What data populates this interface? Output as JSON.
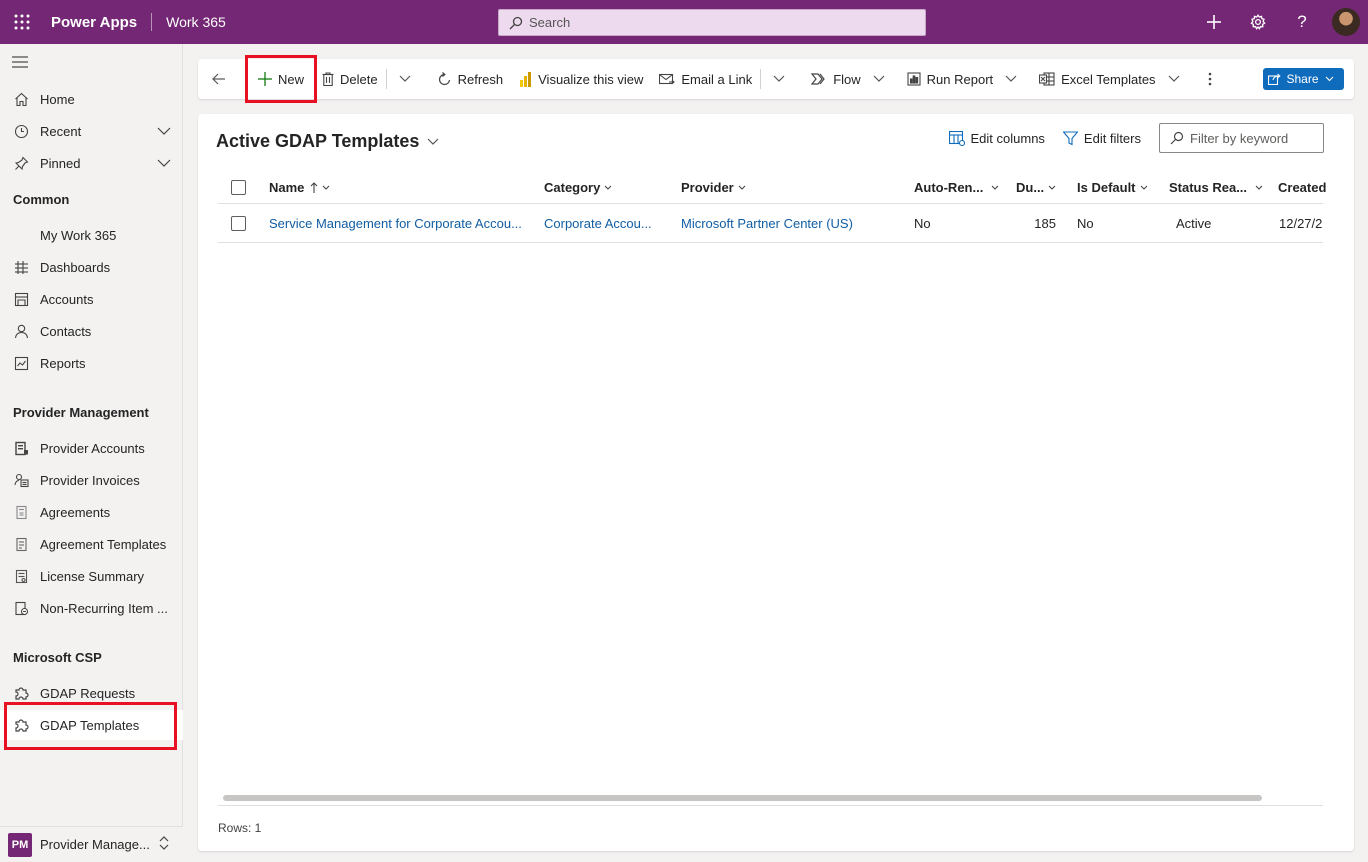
{
  "topbar": {
    "app_name": "Power Apps",
    "environment": "Work 365",
    "search_placeholder": "Search",
    "icons": [
      "waffle-icon",
      "plus-icon",
      "gear-icon",
      "help-icon",
      "avatar"
    ],
    "color": "#742774"
  },
  "sidebar": {
    "items_top": [
      {
        "label": "Home",
        "icon": "home-icon"
      },
      {
        "label": "Recent",
        "icon": "clock-icon"
      },
      {
        "label": "Pinned",
        "icon": "pin-icon"
      }
    ],
    "groups": [
      {
        "title": "Common",
        "items": [
          {
            "label": "My Work 365",
            "icon": ""
          },
          {
            "label": "Dashboards",
            "icon": "dashboard-icon"
          },
          {
            "label": "Accounts",
            "icon": "accounts-icon"
          },
          {
            "label": "Contacts",
            "icon": "contact-icon"
          },
          {
            "label": "Reports",
            "icon": "report-icon"
          }
        ]
      },
      {
        "title": "Provider Management",
        "items": [
          {
            "label": "Provider Accounts",
            "icon": "provider-accounts-icon"
          },
          {
            "label": "Provider Invoices",
            "icon": "invoice-icon"
          },
          {
            "label": "Agreements",
            "icon": "agreement-icon"
          },
          {
            "label": "Agreement Templates",
            "icon": "template-icon"
          },
          {
            "label": "License Summary",
            "icon": "license-icon"
          },
          {
            "label": "Non-Recurring Item ...",
            "icon": "non-recurring-icon"
          }
        ]
      },
      {
        "title": "Microsoft CSP",
        "items": [
          {
            "label": "GDAP Requests",
            "icon": "puzzle-icon"
          },
          {
            "label": "GDAP Templates",
            "icon": "puzzle-icon",
            "selected": true
          }
        ]
      }
    ],
    "area": {
      "badge": "PM",
      "name": "Provider Manage..."
    }
  },
  "commandbar": {
    "new": "New",
    "delete": "Delete",
    "refresh": "Refresh",
    "visualize": "Visualize this view",
    "email_link": "Email a Link",
    "flow": "Flow",
    "run_report": "Run Report",
    "excel_templates": "Excel Templates",
    "share": "Share"
  },
  "view": {
    "title": "Active GDAP Templates",
    "edit_columns": "Edit columns",
    "edit_filters": "Edit filters",
    "filter_placeholder": "Filter by keyword",
    "columns": [
      "Name",
      "Category",
      "Provider",
      "Auto-Ren...",
      "Du...",
      "Is Default",
      "Status Rea...",
      "Created"
    ],
    "rows": [
      {
        "name": "Service Management for Corporate Accou...",
        "category": "Corporate Accou...",
        "provider": "Microsoft Partner Center (US)",
        "auto_renew": "No",
        "duration": "185",
        "is_default": "No",
        "status_reason": "Active",
        "created": "12/27/2"
      }
    ],
    "rows_label": "Rows: 1"
  }
}
